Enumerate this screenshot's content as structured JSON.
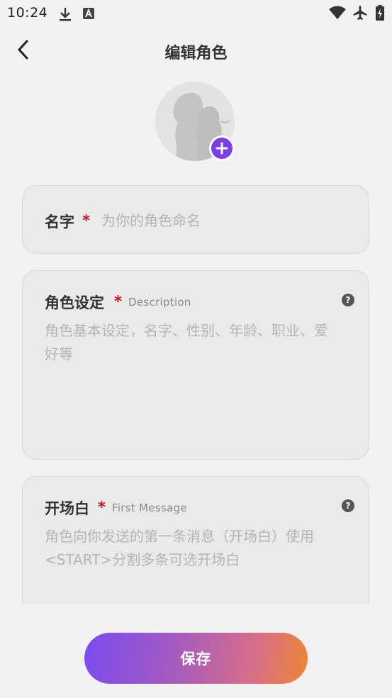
{
  "status_bar": {
    "time": "10:24",
    "icons": [
      "download-icon",
      "a-icon",
      "wifi-icon",
      "airplane-icon",
      "battery-icon"
    ]
  },
  "header": {
    "title": "编辑角色",
    "back_icon": "chevron-left-icon"
  },
  "avatar": {
    "add_icon": "plus-icon",
    "accent": "#7b3fe4"
  },
  "fields": {
    "name": {
      "label": "名字",
      "required_mark": "*",
      "placeholder": "为你的角色命名"
    },
    "description": {
      "label": "角色设定",
      "required_mark": "*",
      "sub_label": "Description",
      "placeholder": "角色基本设定，名字、性别、年龄、职业、爱好等",
      "help_icon": "question-icon"
    },
    "first_message": {
      "label": "开场白",
      "required_mark": "*",
      "sub_label": "First Message",
      "placeholder": "角色向你发送的第一条消息（开场白）使用<START>分割多条可选开场白",
      "help_icon": "question-icon"
    }
  },
  "footer": {
    "save_label": "保存"
  },
  "colors": {
    "required": "#c8141e",
    "gradient_start": "#7a4bf0",
    "gradient_end": "#ee8630"
  }
}
